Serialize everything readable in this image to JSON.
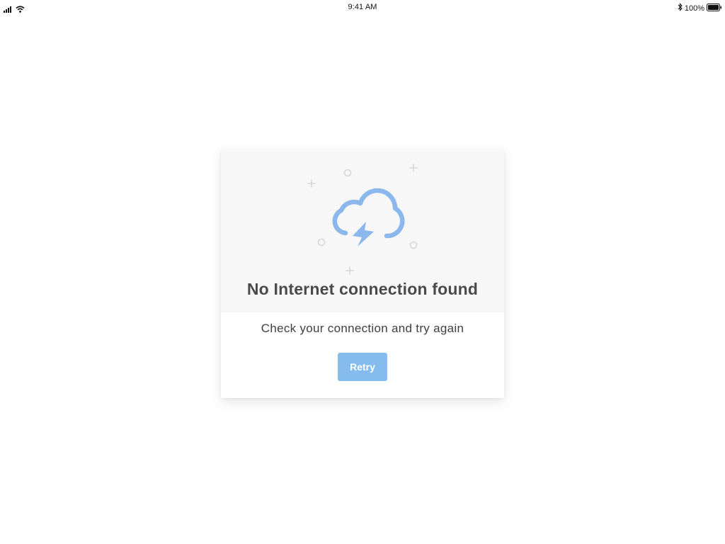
{
  "status_bar": {
    "time": "9:41 AM",
    "battery": "100%",
    "icons": [
      "signal-icon",
      "wifi-icon",
      "bluetooth-icon",
      "battery-icon"
    ]
  },
  "dialog": {
    "illustration": "cloud-lightning-icon",
    "title": "No Internet connection found",
    "message": "Check your connection and try again",
    "retry_label": "Retry"
  },
  "colors": {
    "accent": "#86bbee",
    "illustration": "#8ab8ec",
    "title": "#4a4a4a",
    "panel": "#f7f7f7"
  }
}
